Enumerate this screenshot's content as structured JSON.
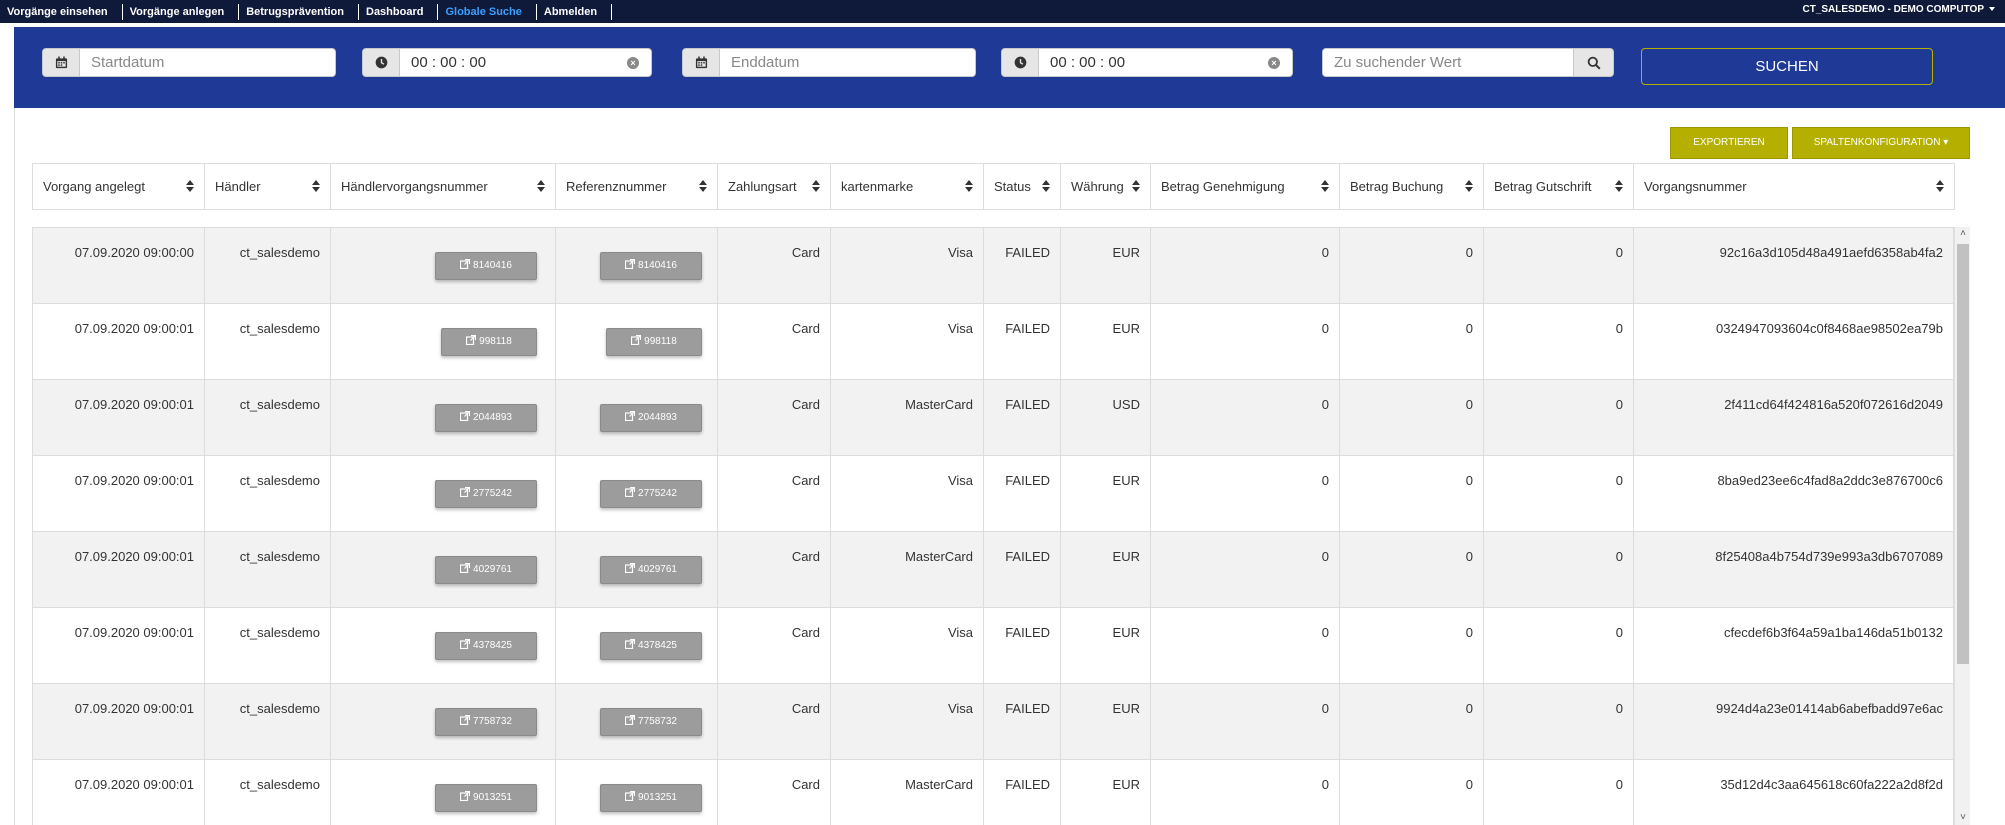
{
  "nav": {
    "items": [
      {
        "label": "Vorgänge einsehen"
      },
      {
        "label": "Vorgänge anlegen"
      },
      {
        "label": "Betrugsprävention"
      },
      {
        "label": "Dashboard"
      },
      {
        "label": "Globale Suche"
      },
      {
        "label": "Abmelden"
      }
    ],
    "active_index": 4,
    "user": "CT_SALESDEMO - DEMO COMPUTOP"
  },
  "search": {
    "start_date_placeholder": "Startdatum",
    "start_time": "00 : 00 : 00",
    "end_date_placeholder": "Enddatum",
    "end_time": "00 : 00 : 00",
    "value_placeholder": "Zu suchender Wert",
    "submit_label": "SUCHEN"
  },
  "actions": {
    "export_label": "EXPORTIEREN",
    "columns_label": "SPALTENKONFIGURATION ▾"
  },
  "colors": {
    "nav_bg": "#0f1a3a",
    "band_bg": "#1e3a96",
    "olive": "#b5b000",
    "active_nav": "#3aa0ff"
  },
  "table": {
    "columns": [
      "Vorgang angelegt",
      "Händler",
      "Händlervorgangsnummer",
      "Referenznummer",
      "Zahlungsart",
      "kartenmarke",
      "Status",
      "Währung",
      "Betrag Genehmigung",
      "Betrag Buchung",
      "Betrag Gutschrift",
      "Vorgangsnummer"
    ],
    "rows": [
      {
        "created": "07.09.2020 09:00:00",
        "merchant": "ct_salesdemo",
        "merchant_ref": "8140416",
        "ref": "8140416",
        "payment": "Card",
        "brand": "Visa",
        "status": "FAILED",
        "currency": "EUR",
        "auth": "0",
        "capture": "0",
        "credit": "0",
        "txid": "92c16a3d105d48a491aefd6358ab4fa2"
      },
      {
        "created": "07.09.2020 09:00:01",
        "merchant": "ct_salesdemo",
        "merchant_ref": "998118",
        "ref": "998118",
        "payment": "Card",
        "brand": "Visa",
        "status": "FAILED",
        "currency": "EUR",
        "auth": "0",
        "capture": "0",
        "credit": "0",
        "txid": "0324947093604c0f8468ae98502ea79b"
      },
      {
        "created": "07.09.2020 09:00:01",
        "merchant": "ct_salesdemo",
        "merchant_ref": "2044893",
        "ref": "2044893",
        "payment": "Card",
        "brand": "MasterCard",
        "status": "FAILED",
        "currency": "USD",
        "auth": "0",
        "capture": "0",
        "credit": "0",
        "txid": "2f411cd64f424816a520f072616d2049"
      },
      {
        "created": "07.09.2020 09:00:01",
        "merchant": "ct_salesdemo",
        "merchant_ref": "2775242",
        "ref": "2775242",
        "payment": "Card",
        "brand": "Visa",
        "status": "FAILED",
        "currency": "EUR",
        "auth": "0",
        "capture": "0",
        "credit": "0",
        "txid": "8ba9ed23ee6c4fad8a2ddc3e876700c6"
      },
      {
        "created": "07.09.2020 09:00:01",
        "merchant": "ct_salesdemo",
        "merchant_ref": "4029761",
        "ref": "4029761",
        "payment": "Card",
        "brand": "MasterCard",
        "status": "FAILED",
        "currency": "EUR",
        "auth": "0",
        "capture": "0",
        "credit": "0",
        "txid": "8f25408a4b754d739e993a3db6707089"
      },
      {
        "created": "07.09.2020 09:00:01",
        "merchant": "ct_salesdemo",
        "merchant_ref": "4378425",
        "ref": "4378425",
        "payment": "Card",
        "brand": "Visa",
        "status": "FAILED",
        "currency": "EUR",
        "auth": "0",
        "capture": "0",
        "credit": "0",
        "txid": "cfecdef6b3f64a59a1ba146da51b0132"
      },
      {
        "created": "07.09.2020 09:00:01",
        "merchant": "ct_salesdemo",
        "merchant_ref": "7758732",
        "ref": "7758732",
        "payment": "Card",
        "brand": "Visa",
        "status": "FAILED",
        "currency": "EUR",
        "auth": "0",
        "capture": "0",
        "credit": "0",
        "txid": "9924d4a23e01414ab6abefbadd97e6ac"
      },
      {
        "created": "07.09.2020 09:00:01",
        "merchant": "ct_salesdemo",
        "merchant_ref": "9013251",
        "ref": "9013251",
        "payment": "Card",
        "brand": "MasterCard",
        "status": "FAILED",
        "currency": "EUR",
        "auth": "0",
        "capture": "0",
        "credit": "0",
        "txid": "35d12d4c3aa645618c60fa222a2d8f2d"
      }
    ]
  }
}
